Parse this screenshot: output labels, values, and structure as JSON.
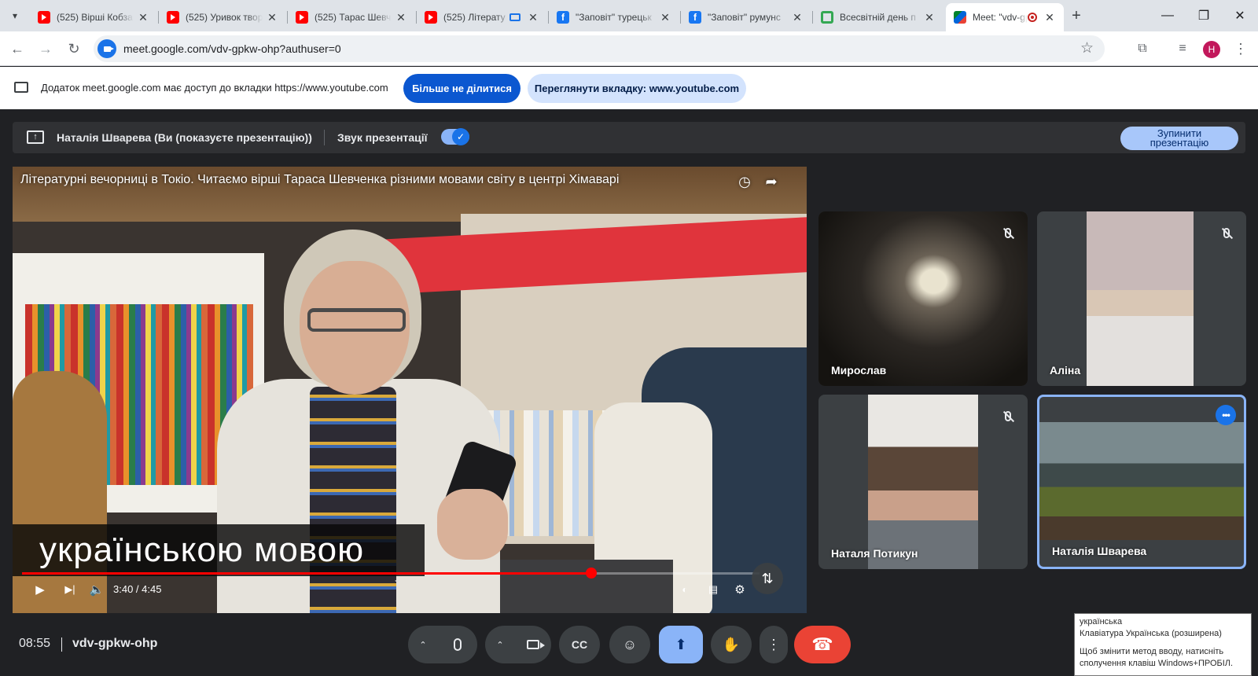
{
  "browser": {
    "tabs": [
      {
        "title": "(525) Вірші Кобза",
        "favicon": "youtube-icon",
        "state": ""
      },
      {
        "title": "(525) Уривок твор",
        "favicon": "youtube-icon",
        "state": ""
      },
      {
        "title": "(525) Тарас Шевч",
        "favicon": "youtube-icon",
        "state": ""
      },
      {
        "title": "(525) Літерату",
        "favicon": "youtube-icon",
        "state": "sharing"
      },
      {
        "title": "\"Заповіт\" турецьк",
        "favicon": "facebook-icon",
        "state": ""
      },
      {
        "title": "\"Заповіт\" румунс",
        "favicon": "facebook-icon",
        "state": ""
      },
      {
        "title": "Всесвітній день п",
        "favicon": "ring-icon",
        "state": ""
      },
      {
        "title": "Meet: \"vdv-gp",
        "favicon": "google-meet-icon",
        "state": "recording"
      }
    ],
    "profile_initial": "H",
    "url": "meet.google.com/vdv-gpkw-ohp?authuser=0"
  },
  "sharebar": {
    "message": "Додаток meet.google.com має доступ до вкладки https://www.youtube.com",
    "stop_sharing_label": "Більше не ділитися",
    "view_tab_label": "Переглянути вкладку: www.youtube.com"
  },
  "presenting": {
    "presenter_label": "Наталія Шварева (Ви (показуєте презентацію))",
    "audio_label": "Звук презентації",
    "audio_enabled": true,
    "stop_label": "Зупинити презентацію"
  },
  "video": {
    "title": "Літературні вечорниці в Токіо. Читаємо вірші Тараса Шевченка різними мовами світу в центрі Хімаварі",
    "subtitle": "українською мовою",
    "time": "3:40 / 4:45",
    "progress_fraction": 0.7719
  },
  "participants": [
    {
      "name": "Мирослав",
      "muted": true
    },
    {
      "name": "Аліна",
      "muted": true
    },
    {
      "name": "Наталя Потикун",
      "muted": true
    },
    {
      "name": "Наталія Шварева",
      "muted": false,
      "selected": true
    }
  ],
  "meeting": {
    "clock": "08:55",
    "code": "vdv-gpkw-ohp"
  },
  "ime_tooltip": {
    "line1": "українська",
    "line2": "Клавіатура Українська (розширена)",
    "line3": "Щоб змінити метод вводу, натисніть",
    "line4": "сполучення клавіш Windows+ПРОБІЛ."
  },
  "colors": {
    "meet_background": "#202124",
    "accent_blue": "#8ab4f8",
    "hangup_red": "#ea4335",
    "progress_red": "#ff0000"
  }
}
